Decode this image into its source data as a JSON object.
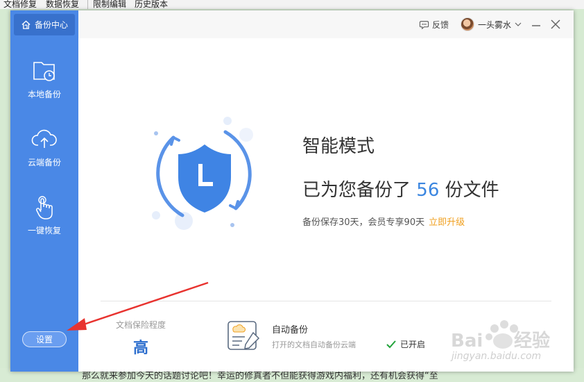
{
  "bg_menu": {
    "items": [
      "文档修复",
      "数据恢复",
      "限制编辑",
      "历史版本"
    ]
  },
  "bg_document": {
    "bottom_text": "那么就来参加今天的话题讨论吧！幸运的修真者不但能获得游戏内福利，还有机会获得“至"
  },
  "sidebar": {
    "home_label": "备份中心",
    "items": [
      {
        "label": "本地备份",
        "icon": "folder-clock-icon"
      },
      {
        "label": "云端备份",
        "icon": "cloud-upload-icon"
      },
      {
        "label": "一键恢复",
        "icon": "hand-tap-icon"
      }
    ],
    "settings_label": "设置"
  },
  "titlebar": {
    "feedback_label": "反馈",
    "username": "一头雾水"
  },
  "main": {
    "mode_title": "智能模式",
    "backup_prefix": "已为您备份了",
    "backup_count": "56",
    "backup_suffix": "份文件",
    "info_text": "备份保存30天，会员专享90天",
    "upgrade_link": "立即升级"
  },
  "footer": {
    "protection_label": "文档保险程度",
    "protection_value": "高",
    "auto_title": "自动备份",
    "auto_desc": "打开的文档自动备份云端",
    "auto_status": "已开启"
  },
  "watermark": {
    "text": "jingyan.baidu.com"
  },
  "colors": {
    "sidebar": "#4a88e6",
    "accent": "#3b86e0",
    "upgrade": "#f0a020",
    "status_check": "#22a33a"
  }
}
